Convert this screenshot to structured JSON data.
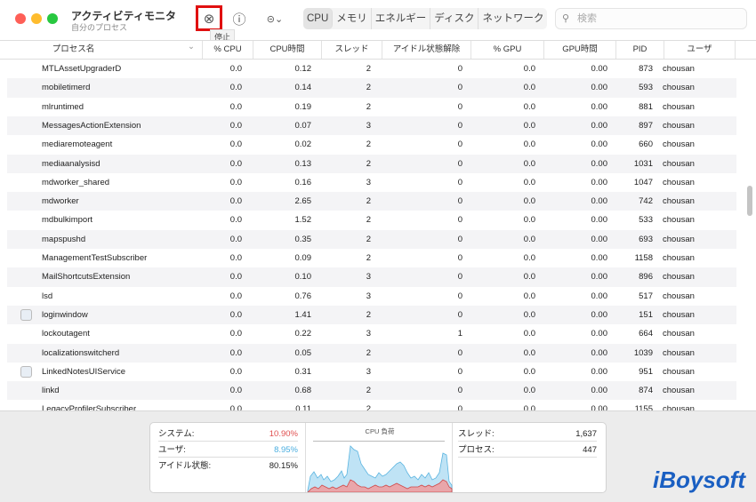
{
  "window": {
    "title": "アクティビティモニタ",
    "subtitle": "自分のプロセス"
  },
  "toolbar": {
    "stop_tooltip": "停止",
    "tabs": [
      "CPU",
      "メモリ",
      "エネルギー",
      "ディスク",
      "ネットワーク"
    ],
    "active_tab": "CPU",
    "search_placeholder": "検索"
  },
  "columns": [
    "プロセス名",
    "% CPU",
    "CPU時間",
    "スレッド",
    "アイドル状態解除",
    "% GPU",
    "GPU時間",
    "PID",
    "ユーザ"
  ],
  "rows": [
    [
      "MTLAssetUpgraderD",
      "0.0",
      "0.12",
      "2",
      "0",
      "0.0",
      "0.00",
      "873",
      "chousan",
      false
    ],
    [
      "mobiletimerd",
      "0.0",
      "0.14",
      "2",
      "0",
      "0.0",
      "0.00",
      "593",
      "chousan",
      false
    ],
    [
      "mlruntimed",
      "0.0",
      "0.19",
      "2",
      "0",
      "0.0",
      "0.00",
      "881",
      "chousan",
      false
    ],
    [
      "MessagesActionExtension",
      "0.0",
      "0.07",
      "3",
      "0",
      "0.0",
      "0.00",
      "897",
      "chousan",
      false
    ],
    [
      "mediaremoteagent",
      "0.0",
      "0.02",
      "2",
      "0",
      "0.0",
      "0.00",
      "660",
      "chousan",
      false
    ],
    [
      "mediaanalysisd",
      "0.0",
      "0.13",
      "2",
      "0",
      "0.0",
      "0.00",
      "1031",
      "chousan",
      false
    ],
    [
      "mdworker_shared",
      "0.0",
      "0.16",
      "3",
      "0",
      "0.0",
      "0.00",
      "1047",
      "chousan",
      false
    ],
    [
      "mdworker",
      "0.0",
      "2.65",
      "2",
      "0",
      "0.0",
      "0.00",
      "742",
      "chousan",
      false
    ],
    [
      "mdbulkimport",
      "0.0",
      "1.52",
      "2",
      "0",
      "0.0",
      "0.00",
      "533",
      "chousan",
      false
    ],
    [
      "mapspushd",
      "0.0",
      "0.35",
      "2",
      "0",
      "0.0",
      "0.00",
      "693",
      "chousan",
      false
    ],
    [
      "ManagementTestSubscriber",
      "0.0",
      "0.09",
      "2",
      "0",
      "0.0",
      "0.00",
      "1158",
      "chousan",
      false
    ],
    [
      "MailShortcutsExtension",
      "0.0",
      "0.10",
      "3",
      "0",
      "0.0",
      "0.00",
      "896",
      "chousan",
      false
    ],
    [
      "lsd",
      "0.0",
      "0.76",
      "3",
      "0",
      "0.0",
      "0.00",
      "517",
      "chousan",
      false
    ],
    [
      "loginwindow",
      "0.0",
      "1.41",
      "2",
      "0",
      "0.0",
      "0.00",
      "151",
      "chousan",
      true
    ],
    [
      "lockoutagent",
      "0.0",
      "0.22",
      "3",
      "1",
      "0.0",
      "0.00",
      "664",
      "chousan",
      false
    ],
    [
      "localizationswitcherd",
      "0.0",
      "0.05",
      "2",
      "0",
      "0.0",
      "0.00",
      "1039",
      "chousan",
      false
    ],
    [
      "LinkedNotesUIService",
      "0.0",
      "0.31",
      "3",
      "0",
      "0.0",
      "0.00",
      "951",
      "chousan",
      true
    ],
    [
      "linkd",
      "0.0",
      "0.68",
      "2",
      "0",
      "0.0",
      "0.00",
      "874",
      "chousan",
      false
    ],
    [
      "LegacyProfilerSubscriber",
      "0.0",
      "0.11",
      "2",
      "0",
      "0.0",
      "0.00",
      "1155",
      "chousan",
      false
    ]
  ],
  "stats": {
    "system_label": "システム:",
    "system": "10.90%",
    "user_label": "ユーザ:",
    "user": "8.95%",
    "idle_label": "アイドル状態:",
    "idle": "80.15%",
    "threads_label": "スレッド:",
    "threads": "1,637",
    "processes_label": "プロセス:",
    "processes": "447",
    "graph_title": "CPU 負荷"
  },
  "colors": {
    "system": "#e05050",
    "user": "#4aaee0",
    "stop_highlight": "#e01010"
  },
  "watermark": "iBoysoft"
}
